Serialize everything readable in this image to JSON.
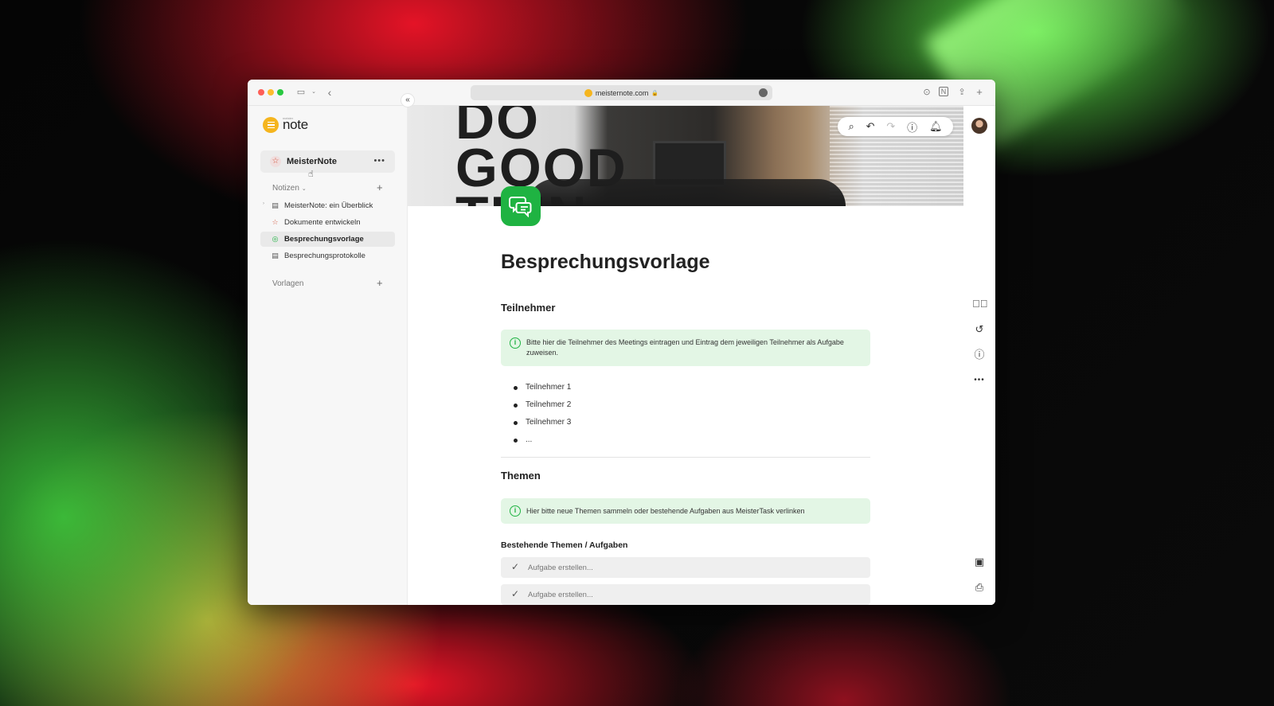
{
  "browser": {
    "url": "meisternote.com",
    "colors": {
      "close": "#fe5f57",
      "minimize": "#febc2e",
      "zoom": "#28c840"
    }
  },
  "app": {
    "logo_text": "note",
    "logo_subtext": "meister",
    "brand_color": "#f5b51e",
    "accent_green": "#1fb342"
  },
  "sidebar": {
    "workspace_name": "MeisterNote",
    "workspace_more": "•••",
    "notes_section": "Notizen",
    "templates_section": "Vorlagen",
    "items": [
      {
        "label": "MeisterNote: ein Überblick",
        "icon": "document-icon",
        "active": false
      },
      {
        "label": "Dokumente entwickeln",
        "icon": "star-icon",
        "active": false
      },
      {
        "label": "Besprechungsvorlage",
        "icon": "chat-icon",
        "active": true
      },
      {
        "label": "Besprechungsprotokolle",
        "icon": "document-icon",
        "active": false
      }
    ]
  },
  "cover": {
    "text_line1": "DO",
    "text_line2": "GOOD",
    "text_line3": "THIN"
  },
  "document": {
    "title": "Besprechungsvorlage",
    "section1_heading": "Teilnehmer",
    "section1_callout": "Bitte hier die Teilnehmer des Meetings eintragen und Eintrag dem jeweiligen Teilnehmer als Aufgabe zuweisen.",
    "participants": [
      "Teilnehmer 1",
      "Teilnehmer 2",
      "Teilnehmer 3",
      "..."
    ],
    "section2_heading": "Themen",
    "section2_callout": "Hier bitte neue Themen sammeln oder bestehende Aufgaben aus MeisterTask verlinken",
    "subsection_heading": "Bestehende Themen / Aufgaben",
    "tasks": [
      "Aufgabe erstellen...",
      "Aufgabe erstellen..."
    ]
  }
}
